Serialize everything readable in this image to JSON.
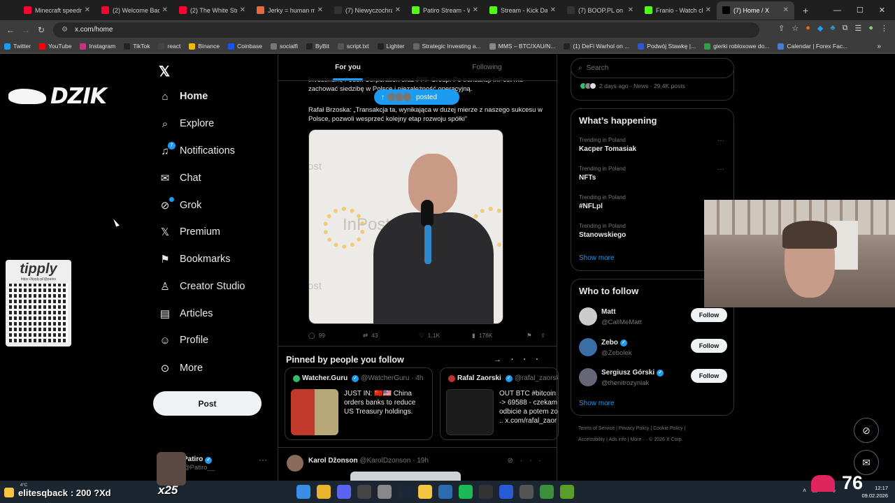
{
  "browser": {
    "tabs": [
      {
        "title": "Minecraft speedru",
        "color": "#ff0033"
      },
      {
        "title": "(2) Welcome Back",
        "color": "#ff0033"
      },
      {
        "title": "(2) The White Strip",
        "color": "#ff0033"
      },
      {
        "title": "Jerky = human m",
        "color": "#e6683c"
      },
      {
        "title": "(7) Niewyczochra",
        "color": "#333333"
      },
      {
        "title": "Patiro Stream - W",
        "color": "#53fc18"
      },
      {
        "title": "Stream - Kick Das",
        "color": "#53fc18"
      },
      {
        "title": "(7) BOOP.PL on X",
        "color": "#333333"
      },
      {
        "title": "Franio - Watch cli",
        "color": "#53fc18"
      },
      {
        "title": "(7) Home / X",
        "color": "#000000"
      }
    ],
    "new_tab": "+",
    "window_controls": [
      "—",
      "☐",
      "✕"
    ],
    "url": "x.com/home",
    "bookmarks": [
      {
        "label": "Twitter",
        "color": "#1d9bf0"
      },
      {
        "label": "YouTube",
        "color": "#ff0000"
      },
      {
        "label": "Instagram",
        "color": "#c13584"
      },
      {
        "label": "TikTok",
        "color": "#222222"
      },
      {
        "label": "react",
        "color": "#444444"
      },
      {
        "label": "Binance",
        "color": "#f0b90b"
      },
      {
        "label": "Coinbase",
        "color": "#1652f0"
      },
      {
        "label": "socialfi",
        "color": "#777777"
      },
      {
        "label": "ByBit",
        "color": "#222222"
      },
      {
        "label": "script.txt",
        "color": "#555555"
      },
      {
        "label": "Lighter",
        "color": "#222222"
      },
      {
        "label": "Strategic Investing a...",
        "color": "#666666"
      },
      {
        "label": "MMS – BTC/XAU/N...",
        "color": "#888888"
      },
      {
        "label": "(1) DeFi Warhol on ...",
        "color": "#222222"
      },
      {
        "label": "Podwój Stawkę |...",
        "color": "#3355cc"
      },
      {
        "label": "gierki robloxowe do...",
        "color": "#2f9e44"
      },
      {
        "label": "Calendar | Forex Fac...",
        "color": "#4a7bd0"
      }
    ]
  },
  "overlay": {
    "brand": "DZIK",
    "tipply_logo": "tipply",
    "tipply_url": "https://tipply.pl/@patiro",
    "chat_user": "elitesqback",
    "chat_message": ": 200 ?Xd",
    "x25": "x25",
    "heart_rate": "76",
    "weather": "4°C",
    "time": "12:17",
    "date": "09.02.2026"
  },
  "nav": {
    "logo": "𝕏",
    "items": [
      {
        "label": "Home",
        "icon": "⌂"
      },
      {
        "label": "Explore",
        "icon": "⌕"
      },
      {
        "label": "Notifications",
        "icon": "♫"
      },
      {
        "label": "Chat",
        "icon": "✉"
      },
      {
        "label": "Grok",
        "icon": "⊘"
      },
      {
        "label": "Premium",
        "icon": "𝕏"
      },
      {
        "label": "Bookmarks",
        "icon": "⚑"
      },
      {
        "label": "Creator Studio",
        "icon": "♙"
      },
      {
        "label": "Articles",
        "icon": "▤"
      },
      {
        "label": "Profile",
        "icon": "☺"
      },
      {
        "label": "More",
        "icon": "⊙"
      }
    ],
    "notification_count": "7",
    "post_button": "Post",
    "account": {
      "name": "Patiro",
      "handle": "@Patiro__",
      "more": "···"
    }
  },
  "feed": {
    "tabs": [
      "For you",
      "Following"
    ],
    "tweet_text_1": "Investment, Fedex Corporation oraz PPF Group. Po transakcji InPost ma zachować siedzibę w Polsce i niezależność operacyjną.",
    "tweet_text_2": "Rafał Brzoska: „Transakcja ta, wynikająca w dużej mierze z naszego sukcesu w Polsce, pozwoli wesprzeć kolejny etap rozwoju spółki”",
    "posted_label": "posted",
    "photo_brand": "InPost",
    "photo_fragment": "ost",
    "actions": {
      "replies": "99",
      "reposts": "43",
      "likes": "1.1K",
      "views": "178K"
    },
    "pinned_title": "Pinned by people you follow",
    "pinned_cards": [
      {
        "name": "Watcher.Guru",
        "handle": "@WatcherGuru · 4h",
        "text": [
          "JUST IN: 🇨🇳🇺🇸 China",
          "orders banks to reduce",
          "US Treasury holdings."
        ]
      },
      {
        "name": "Rafal Zaorski",
        "handle": "@rafal_zaorski",
        "text": [
          "OUT BTC #bitcoin",
          "-> 69588 - czekam",
          "odbicie a potem zo",
          ".. x.com/rafal_zaor"
        ]
      }
    ],
    "next_tweet": {
      "name": "Karol Džonson",
      "handle": "@KarolDzonson · 19h"
    }
  },
  "sidebar": {
    "search_placeholder": "Search",
    "news_meta": "2 days ago · News · 29.4K posts",
    "whats_happening": "What’s happening",
    "trends": [
      {
        "context": "Trending in Poland",
        "title": "Kacper Tomasiak"
      },
      {
        "context": "Trending in Poland",
        "title": "NFTs"
      },
      {
        "context": "Trending in Poland",
        "title": "#NFLpl"
      },
      {
        "context": "Trending in Poland",
        "title": "Stanowskiego"
      }
    ],
    "show_more": "Show more",
    "who_to_follow": "Who to follow",
    "suggestions": [
      {
        "name": "Matt",
        "handle": "@CallMeMatt",
        "verified": false
      },
      {
        "name": "Zebo",
        "handle": "@Zebolek",
        "verified": true
      },
      {
        "name": "Sergiusz Górski",
        "handle": "@thenitrozyniak",
        "verified": true
      }
    ],
    "follow_label": "Follow",
    "footer_1": "Terms of Service  |  Privacy Policy  |  Cookie Policy  |",
    "footer_2": "Accessibility  |  Ads info  |  More ···  © 2026 X Corp."
  }
}
